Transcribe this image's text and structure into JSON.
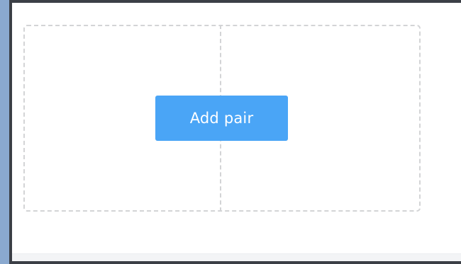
{
  "pair_area": {
    "add_button_label": "Add pair"
  },
  "colors": {
    "accent": "#4aa5f6",
    "window_frame": "#3b3f46",
    "desktop_background": "#8aa9cf",
    "dashed_border": "#d3d4d6"
  }
}
